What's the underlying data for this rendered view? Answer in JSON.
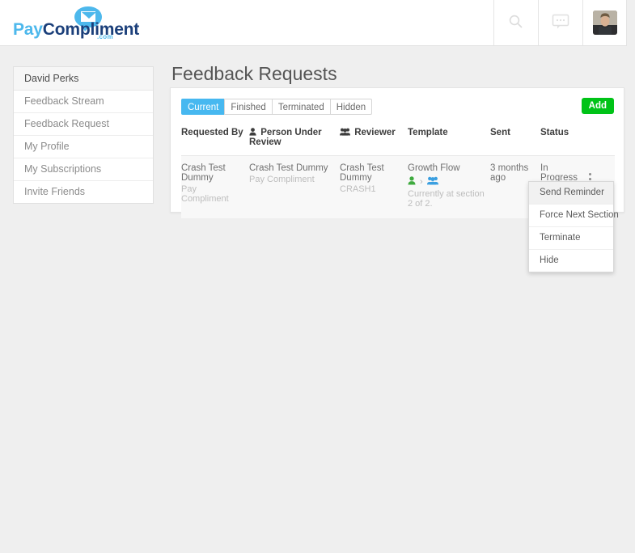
{
  "header": {
    "logo": {
      "part1": "Pay",
      "part2": "Compliment",
      "domain": ".com"
    },
    "icons": [
      {
        "name": "search-icon",
        "label": "Search"
      },
      {
        "name": "messages-icon",
        "label": "Messages"
      },
      {
        "name": "avatar",
        "label": "David Perks"
      }
    ]
  },
  "sidebar": {
    "user": "David Perks",
    "items": [
      {
        "label": "Feedback Stream"
      },
      {
        "label": "Feedback Request"
      },
      {
        "label": "My Profile"
      },
      {
        "label": "My Subscriptions"
      },
      {
        "label": "Invite Friends"
      }
    ]
  },
  "main": {
    "title": "Feedback Requests",
    "add_label": "Add",
    "tabs": [
      {
        "label": "Current",
        "active": true
      },
      {
        "label": "Finished",
        "active": false
      },
      {
        "label": "Terminated",
        "active": false
      },
      {
        "label": "Hidden",
        "active": false
      }
    ],
    "table": {
      "columns": [
        {
          "label": "Requested By",
          "icon": ""
        },
        {
          "label": "Person Under Review",
          "icon": "person-icon"
        },
        {
          "label": "Reviewer",
          "icon": "group-icon"
        },
        {
          "label": "Template",
          "icon": ""
        },
        {
          "label": "Sent",
          "icon": ""
        },
        {
          "label": "Status",
          "icon": ""
        },
        {
          "label": "",
          "icon": ""
        }
      ],
      "rows": [
        {
          "requested_by": "Crash Test Dummy",
          "requested_by_sub": "Pay Compliment",
          "person_under_review": "Crash Test Dummy",
          "person_under_review_sub": "Pay Compliment",
          "reviewer": "Crash Test Dummy",
          "reviewer_sub": "CRASH1",
          "template": "Growth Flow",
          "template_progress": "Currently at section 2 of 2.",
          "flow_chevron": "›",
          "sent": "3 months ago",
          "status": "In Progress"
        }
      ]
    }
  },
  "dropdown": {
    "items": [
      {
        "label": "Send Reminder",
        "hover": true
      },
      {
        "label": "Force Next Section",
        "hover": false
      },
      {
        "label": "Terminate",
        "hover": false
      },
      {
        "label": "Hide",
        "hover": false
      }
    ]
  },
  "colors": {
    "accent_blue": "#47b8f0",
    "add_green": "#00c317",
    "logo_navy": "#1b3f7a",
    "person_green": "#3faa3f",
    "group_blue": "#3b9fe0"
  }
}
